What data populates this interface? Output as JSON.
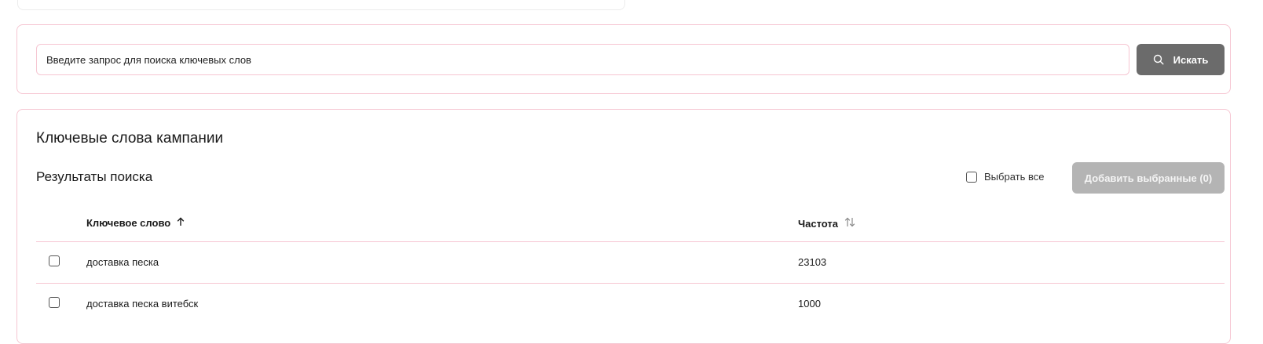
{
  "search": {
    "placeholder": "Введите запрос для поиска ключевых слов",
    "value": "",
    "button_label": "Искать"
  },
  "results": {
    "campaign_title": "Ключевые слова кампании",
    "results_title": "Результаты поиска",
    "select_all_label": "Выбрать все",
    "add_selected_label": "Добавить выбранные (0)",
    "columns": {
      "keyword": "Ключевое слово",
      "frequency": "Частота"
    },
    "rows": [
      {
        "keyword": "доставка песка",
        "frequency": "23103"
      },
      {
        "keyword": "доставка песка витебск",
        "frequency": "1000"
      }
    ]
  },
  "icons": {
    "search_button": "search-icon",
    "keyword_sort": "arrow-up-icon",
    "frequency_sort": "sort-icon"
  },
  "colors": {
    "accent_border": "#f6c6d2",
    "primary_button": "#6b6b6b",
    "disabled_button": "#b4b4b4"
  }
}
